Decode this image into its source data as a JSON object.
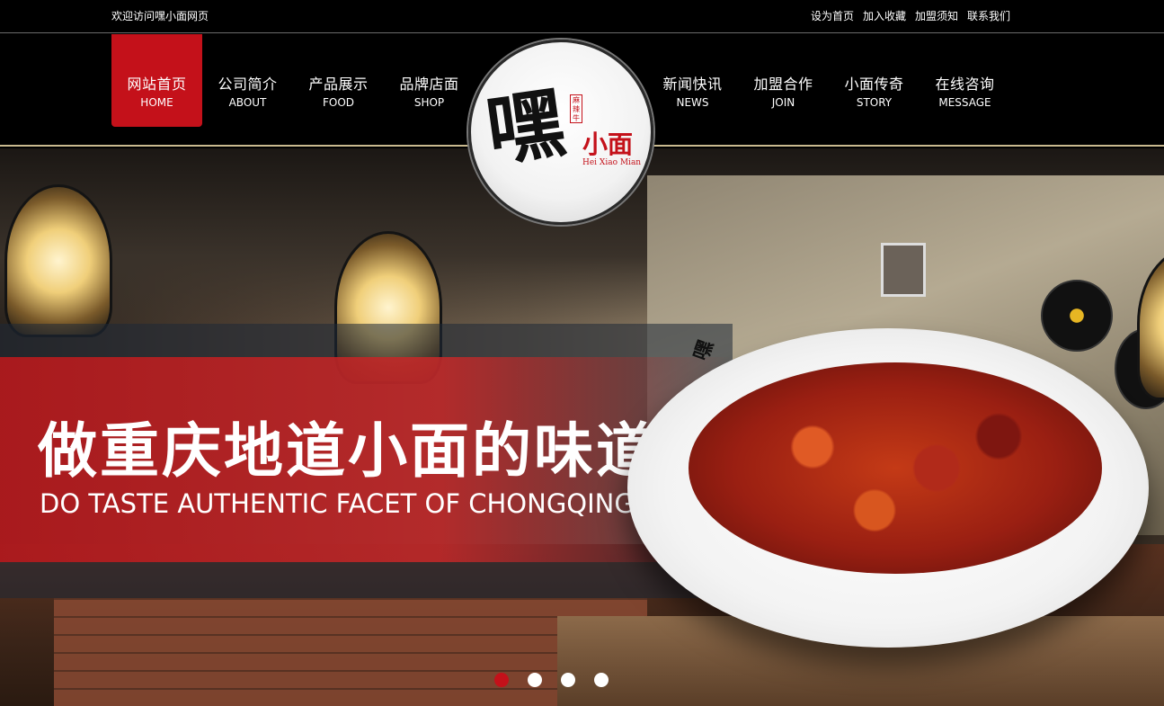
{
  "topbar": {
    "welcome": "欢迎访问嘿小面网页",
    "links": [
      "设为首页",
      "加入收藏",
      "加盟须知",
      "联系我们"
    ]
  },
  "nav": {
    "items": [
      {
        "cn": "网站首页",
        "en": "HOME",
        "active": true
      },
      {
        "cn": "公司简介",
        "en": "ABOUT"
      },
      {
        "cn": "产品展示",
        "en": "FOOD"
      },
      {
        "cn": "品牌店面",
        "en": "SHOP"
      },
      {
        "cn": "新闻快讯",
        "en": "NEWS"
      },
      {
        "cn": "加盟合作",
        "en": "JOIN"
      },
      {
        "cn": "小面传奇",
        "en": "STORY"
      },
      {
        "cn": "在线咨询",
        "en": "MESSAGE"
      }
    ]
  },
  "logo": {
    "mark": "嘿",
    "sub": "小面",
    "seal": "麻辣牛",
    "en": "Hei Xiao Mian"
  },
  "hero": {
    "slogan_cn": "做重庆地道小面的味道",
    "slogan_en": "DO TASTE AUTHENTIC FACET OF CHONGQING",
    "slides": 4,
    "active_slide": 1
  },
  "colors": {
    "accent": "#c4111a",
    "background": "#000000",
    "nav_border": "#c9b98f"
  }
}
